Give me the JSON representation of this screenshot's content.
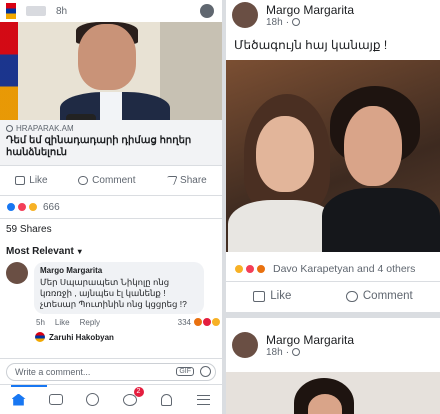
{
  "left_post": {
    "time": "8h",
    "link": {
      "source": "HRAPARAK.AM",
      "headline": "Դեմ եմ զինադադարի դիմաց հողեր հանձնելուն"
    },
    "actions": {
      "like": "Like",
      "comment": "Comment",
      "share": "Share"
    },
    "reaction_count": "666",
    "shares": "59 Shares",
    "sort_label": "Most Relevant",
    "comment": {
      "author": "Margo Margarita",
      "text": "Մեր Սպարապետ Նիկոլը ոնց կռռռջի , այնպես էլ կանենք ! չտեսար Պուտինին ոնց կցցրեց !?",
      "time": "5h",
      "like": "Like",
      "reply": "Reply",
      "reaction_count": "334"
    },
    "reply_author": "Zaruhi Hakobyan",
    "write_placeholder": "Write a comment...",
    "gif_label": "GIF",
    "notifications_badge": "2"
  },
  "right_post": {
    "author": "Margo Margarita",
    "time": "18h",
    "text": "Մեծագույն հայ կանայք !",
    "reactions_text": "Davo Karapetyan and 4 others",
    "actions": {
      "like": "Like",
      "comment": "Comment"
    }
  },
  "right_post2": {
    "author": "Margo Margarita",
    "time": "18h"
  },
  "colors": {
    "facebook_blue": "#1877f2",
    "notification_red": "#e41e3f",
    "like_blue": "#1877f2",
    "love_red": "#f33e58",
    "haha_yellow": "#f7b125"
  }
}
